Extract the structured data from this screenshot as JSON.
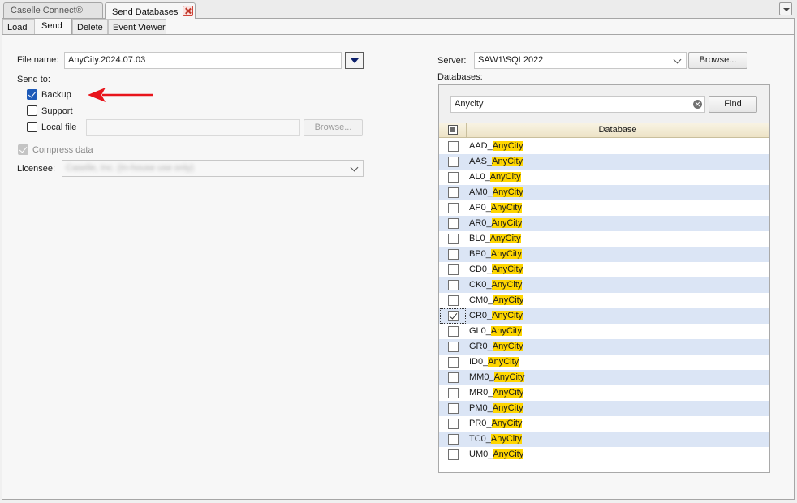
{
  "doc_tabs": [
    {
      "label": "Caselle Connect®",
      "active": false
    },
    {
      "label": "Send Databases",
      "active": true
    }
  ],
  "sub_tabs": [
    {
      "label": "Load",
      "active": false
    },
    {
      "label": "Send",
      "active": true
    },
    {
      "label": "Delete",
      "active": false
    },
    {
      "label": "Event Viewer",
      "active": false
    }
  ],
  "form": {
    "file_name_label": "File name:",
    "file_name_value": "AnyCity.2024.07.03",
    "send_to_label": "Send to:",
    "backup_label": "Backup",
    "backup_checked": true,
    "support_label": "Support",
    "support_checked": false,
    "local_file_label": "Local file",
    "local_file_checked": false,
    "local_file_value": "",
    "browse_label": "Browse...",
    "compress_label": "Compress data",
    "compress_checked": true,
    "licensee_label": "Licensee:",
    "licensee_value": "Caselle, Inc. (In-house use only)"
  },
  "server": {
    "server_label": "Server:",
    "server_value": "SAW1\\SQL2022",
    "browse_label": "Browse...",
    "databases_label": "Databases:",
    "filter_value": "Anycity",
    "find_label": "Find",
    "column_header": "Database"
  },
  "databases": {
    "highlight": "AnyCity",
    "rows": [
      {
        "prefix": "AAD_",
        "checked": false
      },
      {
        "prefix": "AAS_",
        "checked": false
      },
      {
        "prefix": "AL0_",
        "checked": false
      },
      {
        "prefix": "AM0_",
        "checked": false
      },
      {
        "prefix": "AP0_",
        "checked": false
      },
      {
        "prefix": "AR0_",
        "checked": false
      },
      {
        "prefix": "BL0_",
        "checked": false
      },
      {
        "prefix": "BP0_",
        "checked": false
      },
      {
        "prefix": "CD0_",
        "checked": false
      },
      {
        "prefix": "CK0_",
        "checked": false
      },
      {
        "prefix": "CM0_",
        "checked": false
      },
      {
        "prefix": "CR0_",
        "checked": true,
        "focused": true
      },
      {
        "prefix": "GL0_",
        "checked": false
      },
      {
        "prefix": "GR0_",
        "checked": false
      },
      {
        "prefix": "ID0_",
        "checked": false
      },
      {
        "prefix": "MM0_",
        "checked": false
      },
      {
        "prefix": "MR0_",
        "checked": false
      },
      {
        "prefix": "PM0_",
        "checked": false
      },
      {
        "prefix": "PR0_",
        "checked": false
      },
      {
        "prefix": "TC0_",
        "checked": false
      },
      {
        "prefix": "UM0_",
        "checked": false
      }
    ]
  },
  "colors": {
    "accent": "#1d5ab8",
    "highlight": "#ffd600",
    "alt_row": "#dbe5f5",
    "arrow": "#e8141b"
  },
  "icons": [
    "tab-close-icon",
    "overflow-menu-icon",
    "dropdown-arrow-icon",
    "chevron-down-icon",
    "clear-search-icon",
    "red-arrow-icon"
  ]
}
